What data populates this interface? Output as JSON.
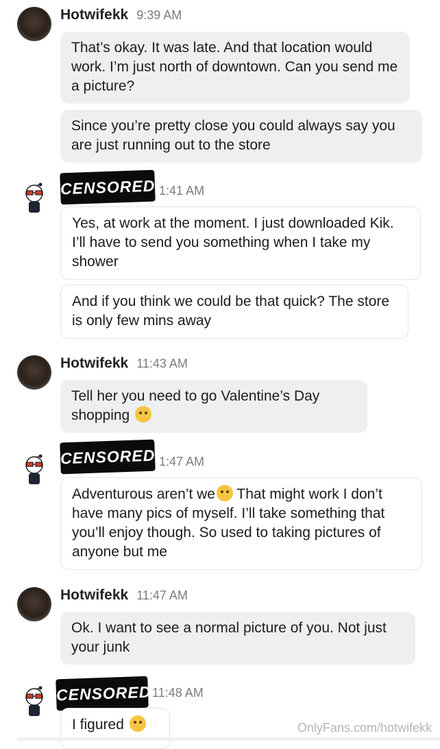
{
  "messages": [
    {
      "user": "Hotwifekk",
      "time": "9:39 AM",
      "bubbles": [
        "That’s okay. It was late. And that location would work. I’m just north of downtown. Can you send me a picture?",
        "Since you’re pretty close you could always say you are just running out to the store"
      ]
    },
    {
      "censor": "CENSORED",
      "time": "1:41 AM",
      "bubbles": [
        "Yes, at work at the moment. I just downloaded Kik. I’ll have to send you something when I take my shower",
        "And if you think we could be that quick? The store is only few mins away"
      ]
    },
    {
      "user": "Hotwifekk",
      "time": "11:43 AM",
      "bubbles": [
        "Tell her you need to go Valentine’s Day shopping"
      ]
    },
    {
      "censor": "CENSORED",
      "time": "1:47 AM",
      "bubbles": [
        "Adventurous aren’t we",
        " That might work I don’t have many pics of myself. I’ll take something that you’ll enjoy though. So used to taking pictures of anyone but me"
      ]
    },
    {
      "user": "Hotwifekk",
      "time": "11:47 AM",
      "bubbles": [
        "Ok. I want to see a normal picture of you. Not just your junk"
      ]
    },
    {
      "censor": "CENSORED",
      "time": "11:48 AM",
      "bubbles": [
        "I figured"
      ]
    }
  ],
  "watermark": "OnlyFans.com/hotwifekk"
}
